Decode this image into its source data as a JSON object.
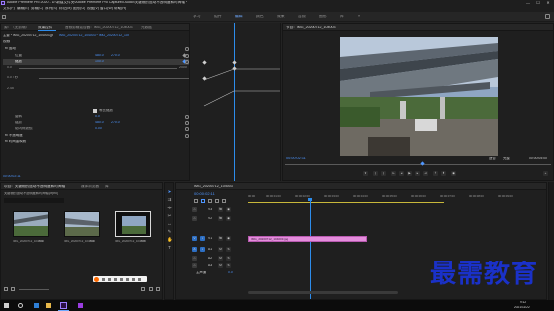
{
  "window": {
    "title": "Adobe Premiere Pro 2020 - D:\\新建文件夹\\Adobe Premiere Pro Captured Audio\\关键帧的运动不透明度和时间轴 *",
    "minimize": "—",
    "maximize": "☐",
    "close": "✕"
  },
  "menu": [
    "文件(F)",
    "编辑(E)",
    "剪辑(C)",
    "序列(S)",
    "标记(M)",
    "图形(G)",
    "视图(V)",
    "窗口(W)",
    "帮助(H)"
  ],
  "workspaces": {
    "items": [
      "学习",
      "组件",
      "编辑",
      "颜色",
      "效果",
      "音频",
      "图形",
      "库"
    ],
    "active": "编辑",
    "more": "»"
  },
  "effect_controls": {
    "tabs": [
      "源：（无剪辑）",
      "效果控件",
      "音频剪辑混合器：IMG_20200712_104003",
      "元数据"
    ],
    "active_tab": "效果控件",
    "master": "主要 * IMG_20200712_104003.jpg",
    "sequence": "IMG_20200712_104003 * IMG_20200712_104003.jpg",
    "timecodes": [
      "00:00",
      "00:00:01:00",
      "00:00:02:00"
    ],
    "clip_bar_label": "IMG_20200712_104003.jpg",
    "section_video": "视频",
    "section_motion": "fx  运动",
    "rows": [
      {
        "label": "位置",
        "v1": "480.0",
        "v2": "270.0"
      },
      {
        "label": "缩放",
        "v1": "100.0",
        "v2": ""
      },
      {
        "label": "",
        "v1": "0.0",
        "v2": "2000"
      },
      {
        "label": "速度",
        "v1": "0.0 / 秒",
        "v2": ""
      },
      {
        "label": "",
        "v1": "2.45",
        "v2": ""
      }
    ],
    "uniform_scale_label": "等比缩放",
    "rotation": {
      "label": "旋转",
      "value": "0.0"
    },
    "anchor": {
      "label": "锚点",
      "v1": "480.0",
      "v2": "270.0"
    },
    "antiflicker": {
      "label": "防闪烁滤镜",
      "value": "0.00"
    },
    "opacity": "fx  不透明度",
    "time_remap": "fx  时间重映射",
    "footer_timecode": "00:00:02:11"
  },
  "program": {
    "tab": "节目：IMG_20200712_104003",
    "timecode": "00:00:02:11",
    "fit": "适合",
    "resolution": "完整",
    "duration": "00:00:05:00"
  },
  "project": {
    "tabs": [
      "项目：关键帧的运动不透明度和时间轴",
      "媒体浏览器",
      "库"
    ],
    "path": "关键帧的运动不透明度和时间轴.prproj",
    "items": [
      {
        "name": "IMG_20200712_104003",
        "duration": "5:00"
      },
      {
        "name": "IMG_20200712_104004",
        "duration": "5:00"
      },
      {
        "name": "IMG_20200712_104005",
        "duration": "5:00"
      }
    ]
  },
  "timeline": {
    "tab": "IMG_20200712_104003",
    "timecode": "00:00:02:11",
    "ruler": [
      "00:00",
      "00:00:01:00",
      "00:00:02:00",
      "00:00:03:00",
      "00:00:04:00",
      "00:00:05:00",
      "00:00:06:00",
      "00:00:07:00",
      "00:00:08:00",
      "00:00:09:00"
    ],
    "tracks": [
      "V3",
      "V2",
      "V1",
      "A1",
      "A2",
      "A3"
    ],
    "master": "主声道",
    "master_value": "0.0",
    "clip_label": "IMG_20200712_104003.jpg"
  },
  "taskbar": {
    "time": "9:12",
    "date": "2021/11/22"
  },
  "watermark": "最需教育",
  "colors": {
    "accent": "#2d8ceb",
    "timecode": "#4e96ff",
    "clip": "#e48ddc",
    "watermark": "#1a31c8"
  }
}
